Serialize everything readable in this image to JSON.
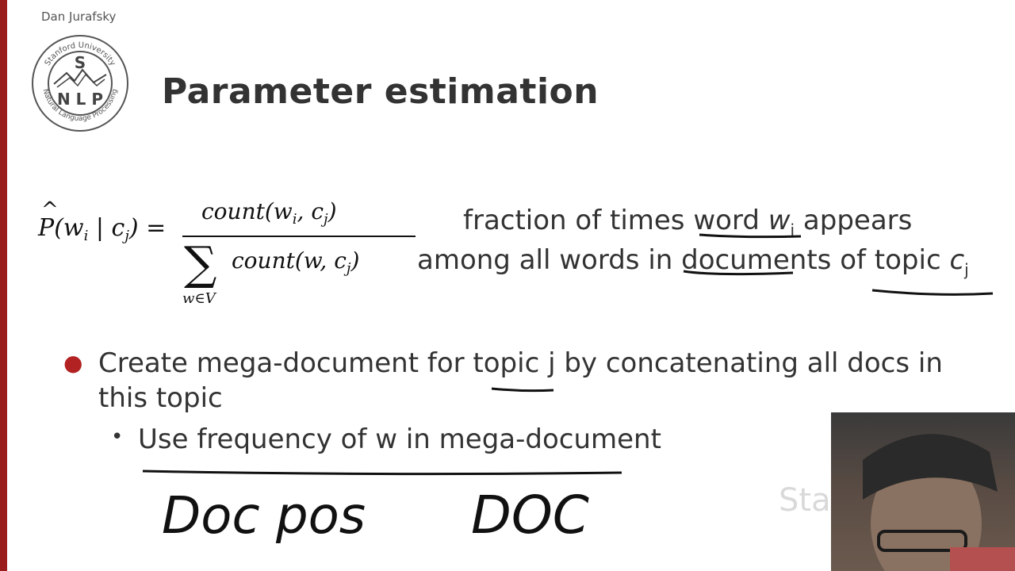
{
  "header": {
    "author": "Dan Jurafsky"
  },
  "logo": {
    "top_text": "Stanford University",
    "letter": "S",
    "middle_text": "N L P",
    "bottom_text": "Natural Language Processing"
  },
  "slide": {
    "title": "Parameter estimation"
  },
  "formula": {
    "lhs": "(w",
    "lhs_sub_i": "i",
    "lhs_mid": " | c",
    "lhs_sub_j": "j",
    "lhs_end": ") =",
    "numerator": "count(w",
    "numerator_sub_i": "i",
    "numerator_mid": ", c",
    "numerator_sub_j": "j",
    "numerator_end": ")",
    "denominator": "count(w, c",
    "denominator_sub_j": "j",
    "denominator_end": ")",
    "sum_subscript": "w∈V"
  },
  "description": {
    "line1_a": "fraction of times ",
    "line1_word": "word",
    "line1_w": " w",
    "line1_sub": "i",
    "line1_b": " appears",
    "line2_a": "among all words in ",
    "line2_docs": "documents",
    "line2_b": " of ",
    "line2_topic": "topic",
    "line2_c": " c",
    "line2_sub": "j"
  },
  "bullets": {
    "b1": "Create mega-document for topic j by concatenating all docs in this topic",
    "b2": "Use frequency of w in mega-document"
  },
  "handwriting": {
    "left": "Doc pos",
    "right": "DOC"
  },
  "watermark": "Sta",
  "colors": {
    "accent": "#9b1c1c",
    "bullet": "#b22222",
    "text": "#333333"
  }
}
